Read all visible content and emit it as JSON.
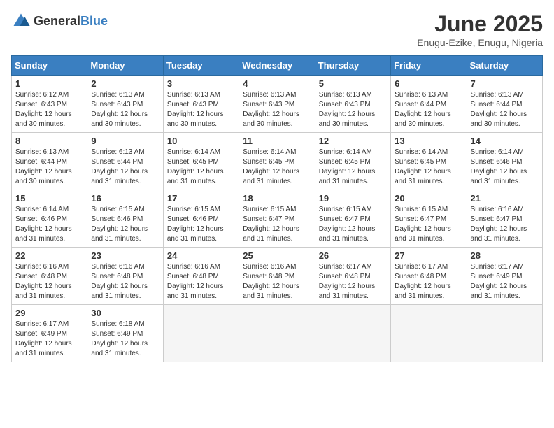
{
  "header": {
    "logo_general": "General",
    "logo_blue": "Blue",
    "month_title": "June 2025",
    "location": "Enugu-Ezike, Enugu, Nigeria"
  },
  "weekdays": [
    "Sunday",
    "Monday",
    "Tuesday",
    "Wednesday",
    "Thursday",
    "Friday",
    "Saturday"
  ],
  "weeks": [
    [
      {
        "day": "1",
        "sunrise": "6:12 AM",
        "sunset": "6:43 PM",
        "daylight": "12 hours and 30 minutes."
      },
      {
        "day": "2",
        "sunrise": "6:13 AM",
        "sunset": "6:43 PM",
        "daylight": "12 hours and 30 minutes."
      },
      {
        "day": "3",
        "sunrise": "6:13 AM",
        "sunset": "6:43 PM",
        "daylight": "12 hours and 30 minutes."
      },
      {
        "day": "4",
        "sunrise": "6:13 AM",
        "sunset": "6:43 PM",
        "daylight": "12 hours and 30 minutes."
      },
      {
        "day": "5",
        "sunrise": "6:13 AM",
        "sunset": "6:43 PM",
        "daylight": "12 hours and 30 minutes."
      },
      {
        "day": "6",
        "sunrise": "6:13 AM",
        "sunset": "6:44 PM",
        "daylight": "12 hours and 30 minutes."
      },
      {
        "day": "7",
        "sunrise": "6:13 AM",
        "sunset": "6:44 PM",
        "daylight": "12 hours and 30 minutes."
      }
    ],
    [
      {
        "day": "8",
        "sunrise": "6:13 AM",
        "sunset": "6:44 PM",
        "daylight": "12 hours and 30 minutes."
      },
      {
        "day": "9",
        "sunrise": "6:13 AM",
        "sunset": "6:44 PM",
        "daylight": "12 hours and 31 minutes."
      },
      {
        "day": "10",
        "sunrise": "6:14 AM",
        "sunset": "6:45 PM",
        "daylight": "12 hours and 31 minutes."
      },
      {
        "day": "11",
        "sunrise": "6:14 AM",
        "sunset": "6:45 PM",
        "daylight": "12 hours and 31 minutes."
      },
      {
        "day": "12",
        "sunrise": "6:14 AM",
        "sunset": "6:45 PM",
        "daylight": "12 hours and 31 minutes."
      },
      {
        "day": "13",
        "sunrise": "6:14 AM",
        "sunset": "6:45 PM",
        "daylight": "12 hours and 31 minutes."
      },
      {
        "day": "14",
        "sunrise": "6:14 AM",
        "sunset": "6:46 PM",
        "daylight": "12 hours and 31 minutes."
      }
    ],
    [
      {
        "day": "15",
        "sunrise": "6:14 AM",
        "sunset": "6:46 PM",
        "daylight": "12 hours and 31 minutes."
      },
      {
        "day": "16",
        "sunrise": "6:15 AM",
        "sunset": "6:46 PM",
        "daylight": "12 hours and 31 minutes."
      },
      {
        "day": "17",
        "sunrise": "6:15 AM",
        "sunset": "6:46 PM",
        "daylight": "12 hours and 31 minutes."
      },
      {
        "day": "18",
        "sunrise": "6:15 AM",
        "sunset": "6:47 PM",
        "daylight": "12 hours and 31 minutes."
      },
      {
        "day": "19",
        "sunrise": "6:15 AM",
        "sunset": "6:47 PM",
        "daylight": "12 hours and 31 minutes."
      },
      {
        "day": "20",
        "sunrise": "6:15 AM",
        "sunset": "6:47 PM",
        "daylight": "12 hours and 31 minutes."
      },
      {
        "day": "21",
        "sunrise": "6:16 AM",
        "sunset": "6:47 PM",
        "daylight": "12 hours and 31 minutes."
      }
    ],
    [
      {
        "day": "22",
        "sunrise": "6:16 AM",
        "sunset": "6:48 PM",
        "daylight": "12 hours and 31 minutes."
      },
      {
        "day": "23",
        "sunrise": "6:16 AM",
        "sunset": "6:48 PM",
        "daylight": "12 hours and 31 minutes."
      },
      {
        "day": "24",
        "sunrise": "6:16 AM",
        "sunset": "6:48 PM",
        "daylight": "12 hours and 31 minutes."
      },
      {
        "day": "25",
        "sunrise": "6:16 AM",
        "sunset": "6:48 PM",
        "daylight": "12 hours and 31 minutes."
      },
      {
        "day": "26",
        "sunrise": "6:17 AM",
        "sunset": "6:48 PM",
        "daylight": "12 hours and 31 minutes."
      },
      {
        "day": "27",
        "sunrise": "6:17 AM",
        "sunset": "6:48 PM",
        "daylight": "12 hours and 31 minutes."
      },
      {
        "day": "28",
        "sunrise": "6:17 AM",
        "sunset": "6:49 PM",
        "daylight": "12 hours and 31 minutes."
      }
    ],
    [
      {
        "day": "29",
        "sunrise": "6:17 AM",
        "sunset": "6:49 PM",
        "daylight": "12 hours and 31 minutes."
      },
      {
        "day": "30",
        "sunrise": "6:18 AM",
        "sunset": "6:49 PM",
        "daylight": "12 hours and 31 minutes."
      },
      null,
      null,
      null,
      null,
      null
    ]
  ]
}
